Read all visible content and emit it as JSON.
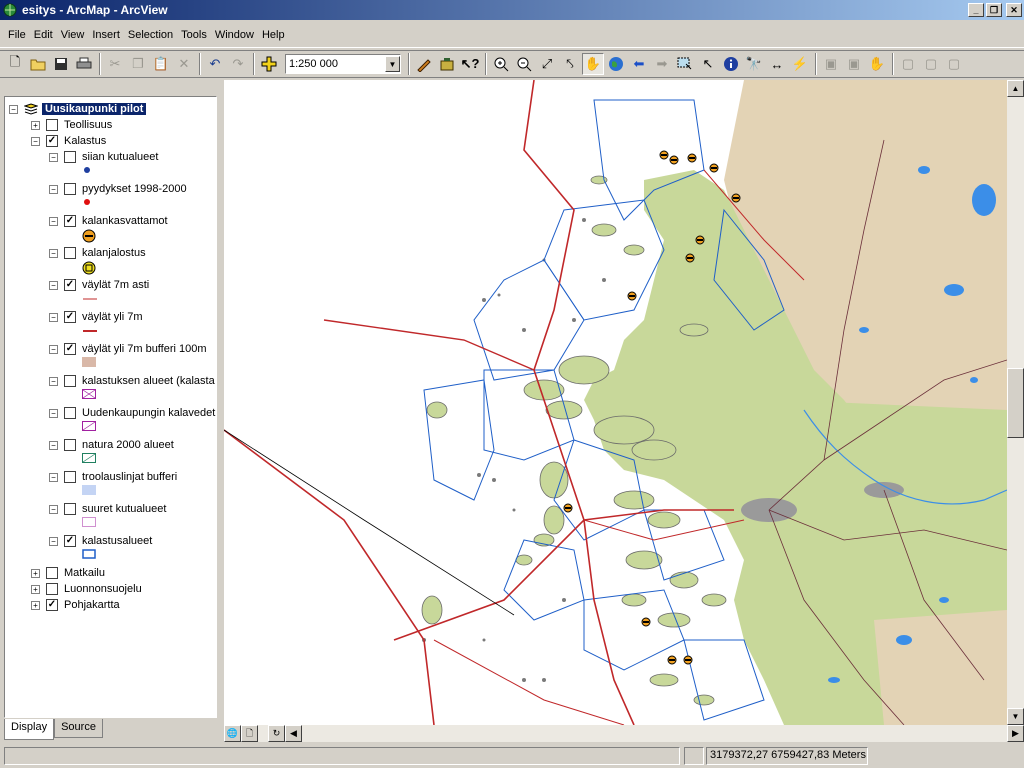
{
  "window": {
    "title": "esitys - ArcMap - ArcView",
    "min_label": "_",
    "restore_label": "❐",
    "close_label": "✕"
  },
  "menubar": {
    "items": [
      "File",
      "Edit",
      "View",
      "Insert",
      "Selection",
      "Tools",
      "Window",
      "Help"
    ]
  },
  "toolbar": {
    "scale_value": "1:250 000",
    "icons": [
      "new-document-icon",
      "open-folder-icon",
      "save-icon",
      "print-icon",
      "cut-icon",
      "copy-icon",
      "paste-icon",
      "delete-icon",
      "undo-icon",
      "redo-icon",
      "add-data-icon",
      "editor-icon",
      "arctoolbox-icon",
      "whats-this-icon",
      "zoom-in-icon",
      "zoom-out-icon",
      "fixed-zoom-in-icon",
      "fixed-zoom-out-icon",
      "pan-icon",
      "full-extent-icon",
      "back-extent-icon",
      "forward-extent-icon",
      "select-by-rectangle-icon",
      "select-elements-icon",
      "identify-icon",
      "find-icon",
      "measure-icon",
      "hyperlink-icon"
    ]
  },
  "toc": {
    "root": "Uusikaupunki pilot",
    "layers": [
      {
        "name": "Teollisuus",
        "checked": false,
        "expanded": false,
        "level": 1
      },
      {
        "name": "Kalastus",
        "checked": true,
        "expanded": true,
        "level": 1
      },
      {
        "name": "siian kutualueet",
        "checked": false,
        "expanded": true,
        "level": 2,
        "symbol": "blue-dot"
      },
      {
        "name": "pyydykset 1998-2000",
        "checked": false,
        "expanded": true,
        "level": 2,
        "symbol": "red-dot"
      },
      {
        "name": "kalankasvattamot",
        "checked": true,
        "expanded": true,
        "level": 2,
        "symbol": "fish-farm-marker"
      },
      {
        "name": "kalanjalostus",
        "checked": false,
        "expanded": true,
        "level": 2,
        "symbol": "fish-processing-marker"
      },
      {
        "name": "väylät 7m asti",
        "checked": true,
        "expanded": true,
        "level": 2,
        "symbol": "thin-red-line"
      },
      {
        "name": "väylät yli 7m",
        "checked": true,
        "expanded": true,
        "level": 2,
        "symbol": "thick-red-line"
      },
      {
        "name": "väylät yli 7m bufferi 100m",
        "checked": true,
        "expanded": true,
        "level": 2,
        "symbol": "tan-fill"
      },
      {
        "name": "kalastuksen alueet (kalasta",
        "checked": false,
        "expanded": true,
        "level": 2,
        "symbol": "purple-hatch"
      },
      {
        "name": "Uudenkaupungin kalavedet",
        "checked": false,
        "expanded": true,
        "level": 2,
        "symbol": "purple-diagonal"
      },
      {
        "name": "natura 2000 alueet",
        "checked": false,
        "expanded": true,
        "level": 2,
        "symbol": "green-hatch"
      },
      {
        "name": "troolauslinjat bufferi",
        "checked": false,
        "expanded": true,
        "level": 2,
        "symbol": "light-blue-fill"
      },
      {
        "name": "suuret kutualueet",
        "checked": false,
        "expanded": true,
        "level": 2,
        "symbol": "purple-dots"
      },
      {
        "name": "kalastusalueet",
        "checked": true,
        "expanded": true,
        "level": 2,
        "symbol": "blue-outline"
      },
      {
        "name": "Matkailu",
        "checked": false,
        "expanded": false,
        "level": 1
      },
      {
        "name": "Luonnonsuojelu",
        "checked": false,
        "expanded": false,
        "level": 1
      },
      {
        "name": "Pohjakartta",
        "checked": true,
        "expanded": false,
        "level": 1
      }
    ]
  },
  "tabs": [
    "Display",
    "Source"
  ],
  "status": {
    "coordinates": "3179372,27  6759427,83 Meters"
  },
  "colors": {
    "land": "#c8d89a",
    "land_tan": "#e3d3b5",
    "water": "#ffffff",
    "island": "#808080",
    "fairway": "#c0282a",
    "fishing_area": "#1f5fc8",
    "lake": "#3b8ee8",
    "road": "#6b2f3a"
  }
}
